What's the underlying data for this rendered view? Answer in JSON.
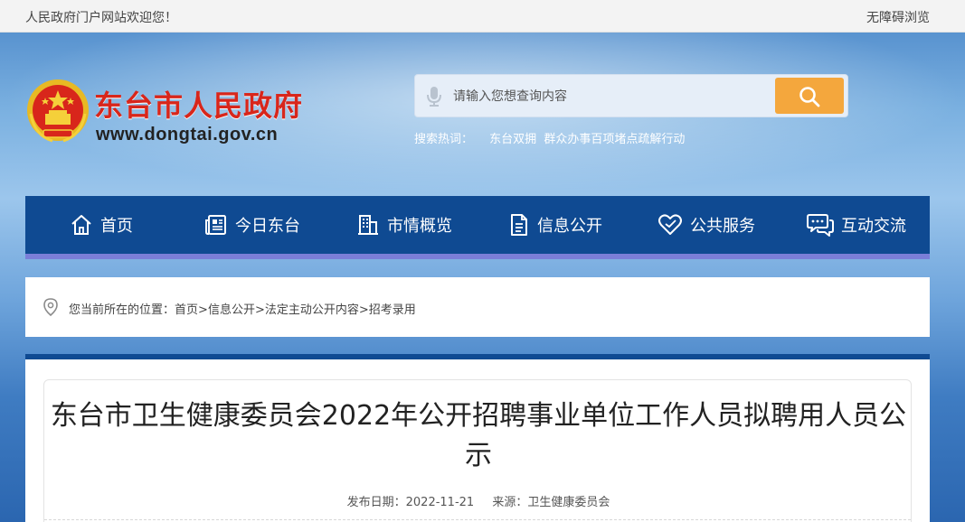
{
  "topbar": {
    "welcome": "人民政府门户网站欢迎您！",
    "accessibility": "无障碍浏览"
  },
  "header": {
    "site_title": "东台市人民政府",
    "site_url": "www.dongtai.gov.cn",
    "emblem_icon": "national-emblem-icon"
  },
  "search": {
    "placeholder": "请输入您想查询内容",
    "hot_label": "搜索热词：",
    "hot_links": [
      "东台双拥",
      "群众办事百项堵点疏解行动"
    ],
    "button_color": "#f4a73d"
  },
  "nav": {
    "items": [
      {
        "label": "首页",
        "icon": "home-icon"
      },
      {
        "label": "今日东台",
        "icon": "newspaper-icon"
      },
      {
        "label": "市情概览",
        "icon": "building-icon"
      },
      {
        "label": "信息公开",
        "icon": "document-icon"
      },
      {
        "label": "公共服务",
        "icon": "heart-icon"
      },
      {
        "label": "互动交流",
        "icon": "chat-icon"
      }
    ],
    "bg_color": "#0f4a92"
  },
  "breadcrumb": {
    "prefix": "您当前所在的位置：",
    "items": [
      "首页",
      "信息公开",
      "法定主动公开内容",
      "招考录用"
    ],
    "separator": ">"
  },
  "article": {
    "title": "东台市卫生健康委员会2022年公开招聘事业单位工作人员拟聘用人员公示",
    "date_label": "发布日期：",
    "date": "2022-11-21",
    "source_label": "来源：",
    "source": "卫生健康委员会"
  }
}
